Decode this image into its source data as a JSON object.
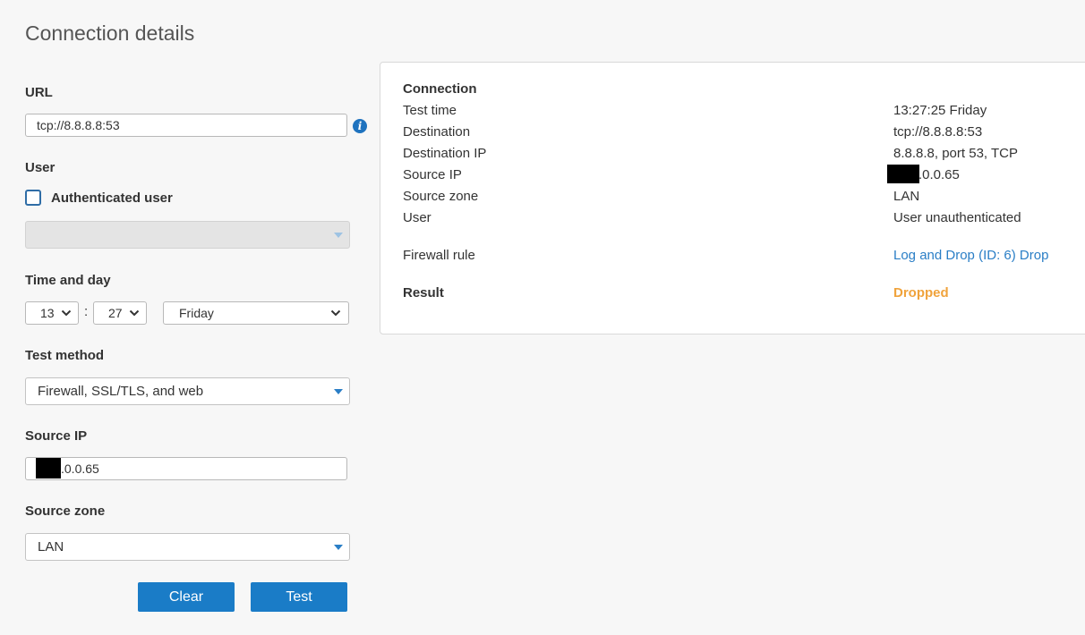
{
  "page": {
    "title": "Connection details"
  },
  "form": {
    "url": {
      "label": "URL",
      "value": "tcp://8.8.8.8:53",
      "info_icon": "info-icon"
    },
    "user": {
      "label": "User",
      "checkbox_label": "Authenticated user",
      "checked": false,
      "select_value": ""
    },
    "time": {
      "label": "Time and day",
      "hour": "13",
      "separator": ":",
      "minute": "27",
      "day": "Friday"
    },
    "test_method": {
      "label": "Test method",
      "value": "Firewall, SSL/TLS, and web"
    },
    "source_ip": {
      "label": "Source IP",
      "value_suffix": ".0.0.65"
    },
    "source_zone": {
      "label": "Source zone",
      "value": "LAN"
    },
    "buttons": {
      "clear": "Clear",
      "test": "Test"
    }
  },
  "result_panel": {
    "section_title": "Connection",
    "rows": [
      {
        "label": "Test time",
        "value": "13:27:25 Friday"
      },
      {
        "label": "Destination",
        "value": "tcp://8.8.8.8:53"
      },
      {
        "label": "Destination IP",
        "value": "8.8.8.8, port 53, TCP"
      },
      {
        "label": "Source IP",
        "value_suffix": ".0.0.65"
      },
      {
        "label": "Source zone",
        "value": "LAN"
      },
      {
        "label": "User",
        "value": "User unauthenticated"
      }
    ],
    "firewall_rule": {
      "label": "Firewall rule",
      "value": "Log and Drop (ID: 6) Drop"
    },
    "result": {
      "label": "Result",
      "value": "Dropped"
    }
  },
  "colors": {
    "accent": "#1a7cc7",
    "link": "#2a7ec6",
    "dropped": "#f0a33c"
  }
}
